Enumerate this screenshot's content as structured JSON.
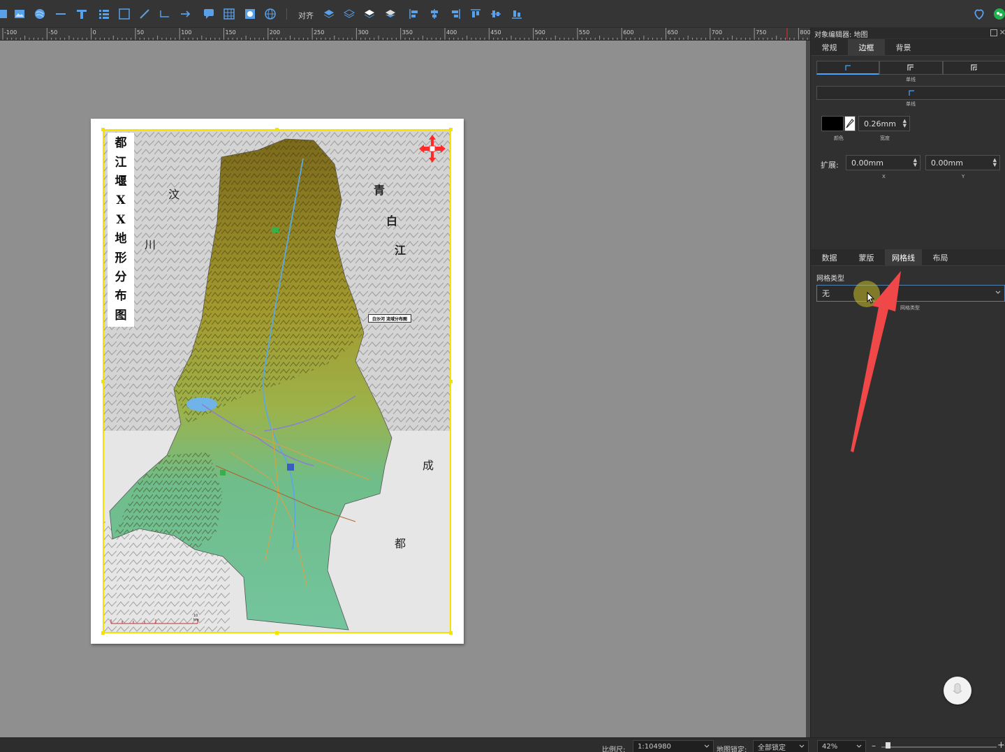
{
  "toolbar": {
    "align_label": "对齐"
  },
  "ruler": {
    "ticks": [
      "-100",
      "-50",
      "0",
      "50",
      "100",
      "150",
      "200",
      "250",
      "300",
      "350",
      "400",
      "450",
      "500",
      "550",
      "600",
      "650",
      "700",
      "750",
      "800"
    ]
  },
  "map": {
    "title_chars": [
      "都",
      "江",
      "堰",
      "X",
      "X",
      "地",
      "形",
      "分",
      "布",
      "图"
    ],
    "labels": {
      "wen": "汶",
      "chuan": "川",
      "qing": "青",
      "bai": "白",
      "jiang": "江",
      "cheng": "成",
      "du": "都"
    },
    "banner": "白沙河 流域分布图",
    "scale_text": "10 km"
  },
  "panel": {
    "title": "对象编辑器: 地图",
    "tabs_top": [
      "常规",
      "边框",
      "背景"
    ],
    "active_top": "边框",
    "style_label_1": "单线",
    "style_label_2": "单线",
    "color_label": "颜色",
    "width_value": "0.26mm",
    "width_label": "宽度",
    "expand_label": "扩展:",
    "expand_x": "0.00mm",
    "expand_y": "0.00mm",
    "x_label": "X",
    "y_label": "Y",
    "tabs_bottom": [
      "数据",
      "蒙版",
      "网格线",
      "布局"
    ],
    "active_bottom": "网格线",
    "grid_type_label": "网格类型",
    "grid_type_value": "无",
    "grid_type_hint": "网格类型"
  },
  "statusbar": {
    "scale_label": "比例尺:",
    "scale_value": "1:104980",
    "lock_label": "地图锁定:",
    "lock_value": "全部锁定",
    "zoom_value": "42%"
  },
  "colors": {
    "accent": "#4aa3ff",
    "selection": "#f4e300",
    "annotation_arrow": "#f04848"
  }
}
